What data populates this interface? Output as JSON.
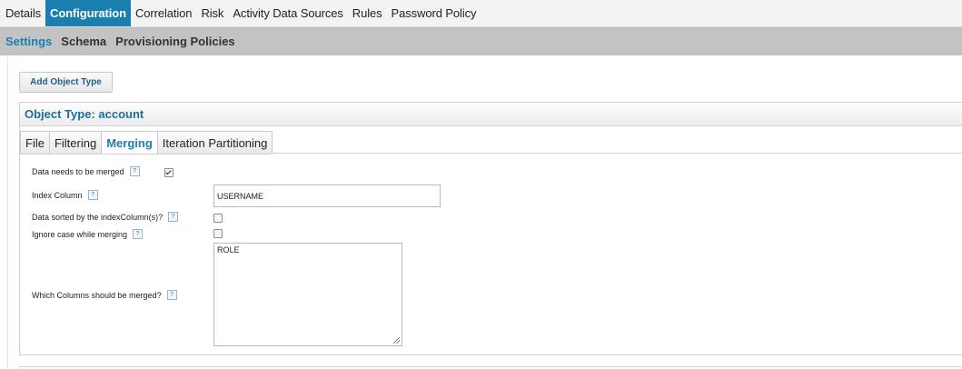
{
  "top_nav": [
    "Details",
    "Configuration",
    "Correlation",
    "Risk",
    "Activity Data Sources",
    "Rules",
    "Password Policy"
  ],
  "top_nav_active": "Configuration",
  "sub_nav": [
    "Settings",
    "Schema",
    "Provisioning Policies"
  ],
  "sub_nav_active": "Settings",
  "add_button_label": "Add Object Type",
  "panel": {
    "title": "Object Type: account",
    "tabs": [
      "File",
      "Filtering",
      "Merging",
      "Iteration Partitioning"
    ],
    "active_tab": "Merging"
  },
  "form": {
    "merge_label": "Data needs to be merged",
    "merge_checked": true,
    "index_label": "Index Column",
    "index_value": "USERNAME",
    "sorted_label": "Data sorted by the indexColumn(s)?",
    "sorted_checked": false,
    "ignore_case_label": "Ignore case while merging",
    "ignore_case_checked": false,
    "columns_label": "Which Columns should be merged?",
    "columns_value": "ROLE",
    "help_glyph": "?"
  }
}
